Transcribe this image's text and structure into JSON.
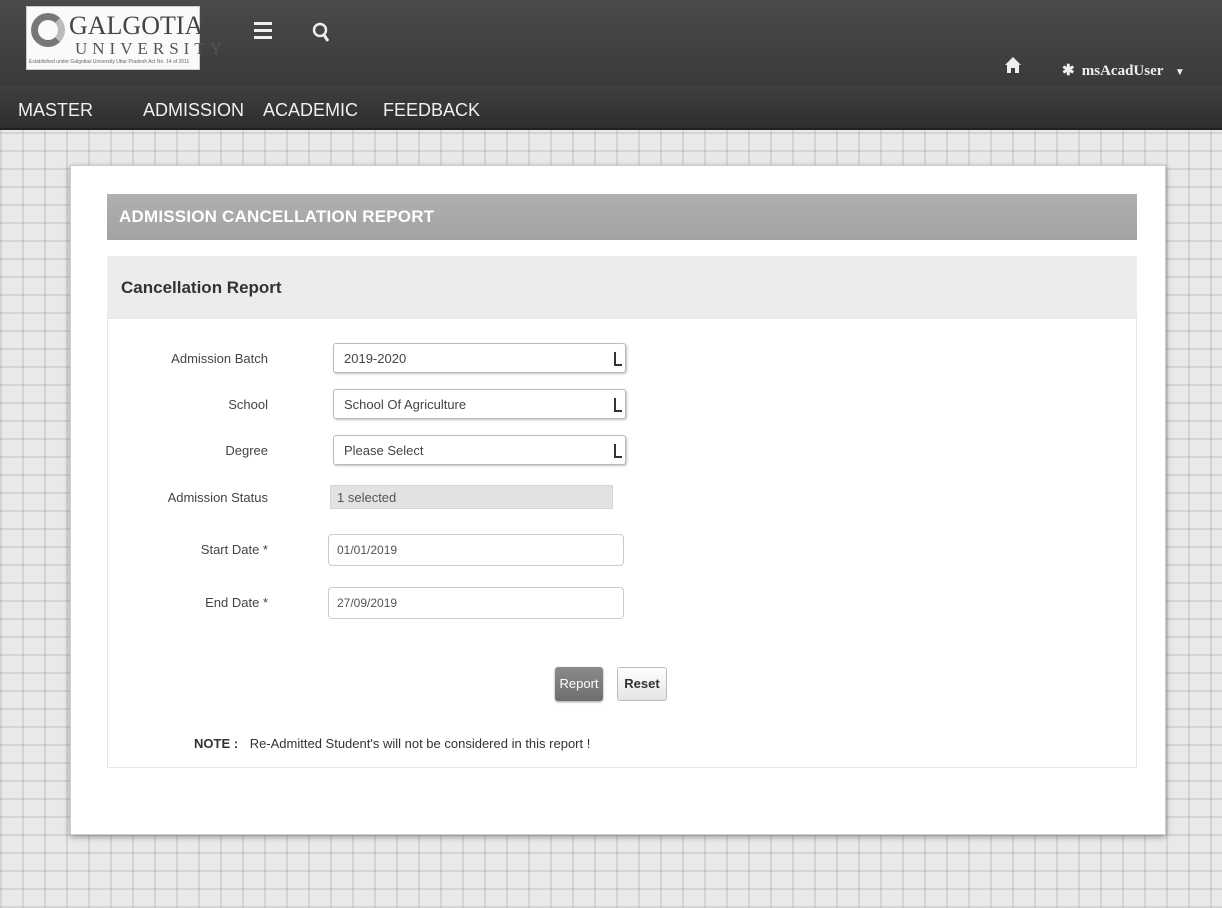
{
  "header": {
    "logo": {
      "name": "GALGOTIAS",
      "university": "UNIVERSITY",
      "tagline": "Established under Galgotias University Uttar Pradesh Act No. 14 of 2011"
    },
    "user_name": "msAcadUser",
    "icons": [
      "menu-icon",
      "search-icon",
      "home-icon",
      "user-icon"
    ]
  },
  "nav": {
    "items": [
      "MASTER",
      "ADMISSION",
      "ACADEMIC",
      "FEEDBACK"
    ]
  },
  "card": {
    "title": "ADMISSION CANCELLATION REPORT",
    "subtitle": "Cancellation Report"
  },
  "form": {
    "admission_batch": {
      "label": "Admission Batch",
      "value": "2019-2020"
    },
    "school": {
      "label": "School",
      "value": "School Of Agriculture"
    },
    "degree": {
      "label": "Degree",
      "value": "Please Select"
    },
    "admission_status": {
      "label": "Admission Status",
      "value": "1 selected"
    },
    "start_date": {
      "label": "Start Date *",
      "value": "01/01/2019"
    },
    "end_date": {
      "label": "End Date *",
      "value": "27/09/2019"
    }
  },
  "buttons": {
    "report": "Report",
    "reset": "Reset"
  },
  "note": {
    "prefix": "NOTE :",
    "text": "Re-Admitted Student's will not be considered in this report !"
  }
}
